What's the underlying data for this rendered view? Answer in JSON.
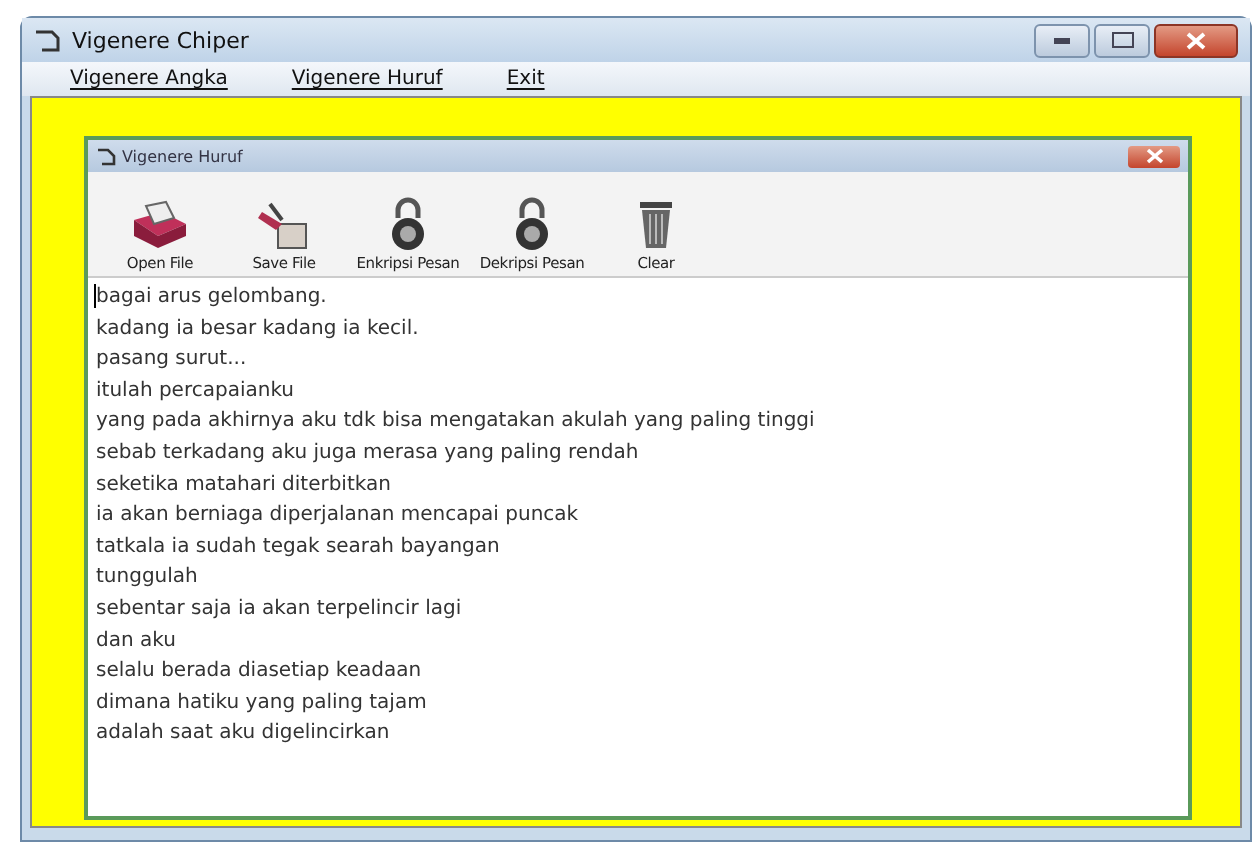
{
  "window": {
    "title": "Vigenere Chiper"
  },
  "menu": [
    "Vigenere Angka",
    "Vigenere Huruf",
    "Exit"
  ],
  "child_window": {
    "title": "Vigenere Huruf",
    "toolbar": [
      {
        "label": "Open File",
        "kind": "open"
      },
      {
        "label": "Save File",
        "kind": "save"
      },
      {
        "label": "Enkripsi Pesan",
        "kind": "lock"
      },
      {
        "label": "Dekripsi Pesan",
        "kind": "lock"
      },
      {
        "label": "Clear",
        "kind": "trash"
      }
    ],
    "text_lines": [
      "bagai arus gelombang.",
      "kadang ia besar kadang ia kecil.",
      "pasang surut...",
      "itulah percapaianku",
      "yang pada akhirnya aku tdk bisa mengatakan akulah yang paling tinggi",
      "sebab terkadang aku juga merasa yang paling rendah",
      "seketika matahari diterbitkan",
      "ia akan berniaga diperjalanan mencapai puncak",
      "tatkala ia sudah tegak searah bayangan",
      "tunggulah",
      "sebentar saja ia akan terpelincir lagi",
      "dan aku",
      "selalu berada diasetiap keadaan",
      "dimana hatiku yang paling tajam",
      "adalah saat aku digelincirkan"
    ]
  }
}
